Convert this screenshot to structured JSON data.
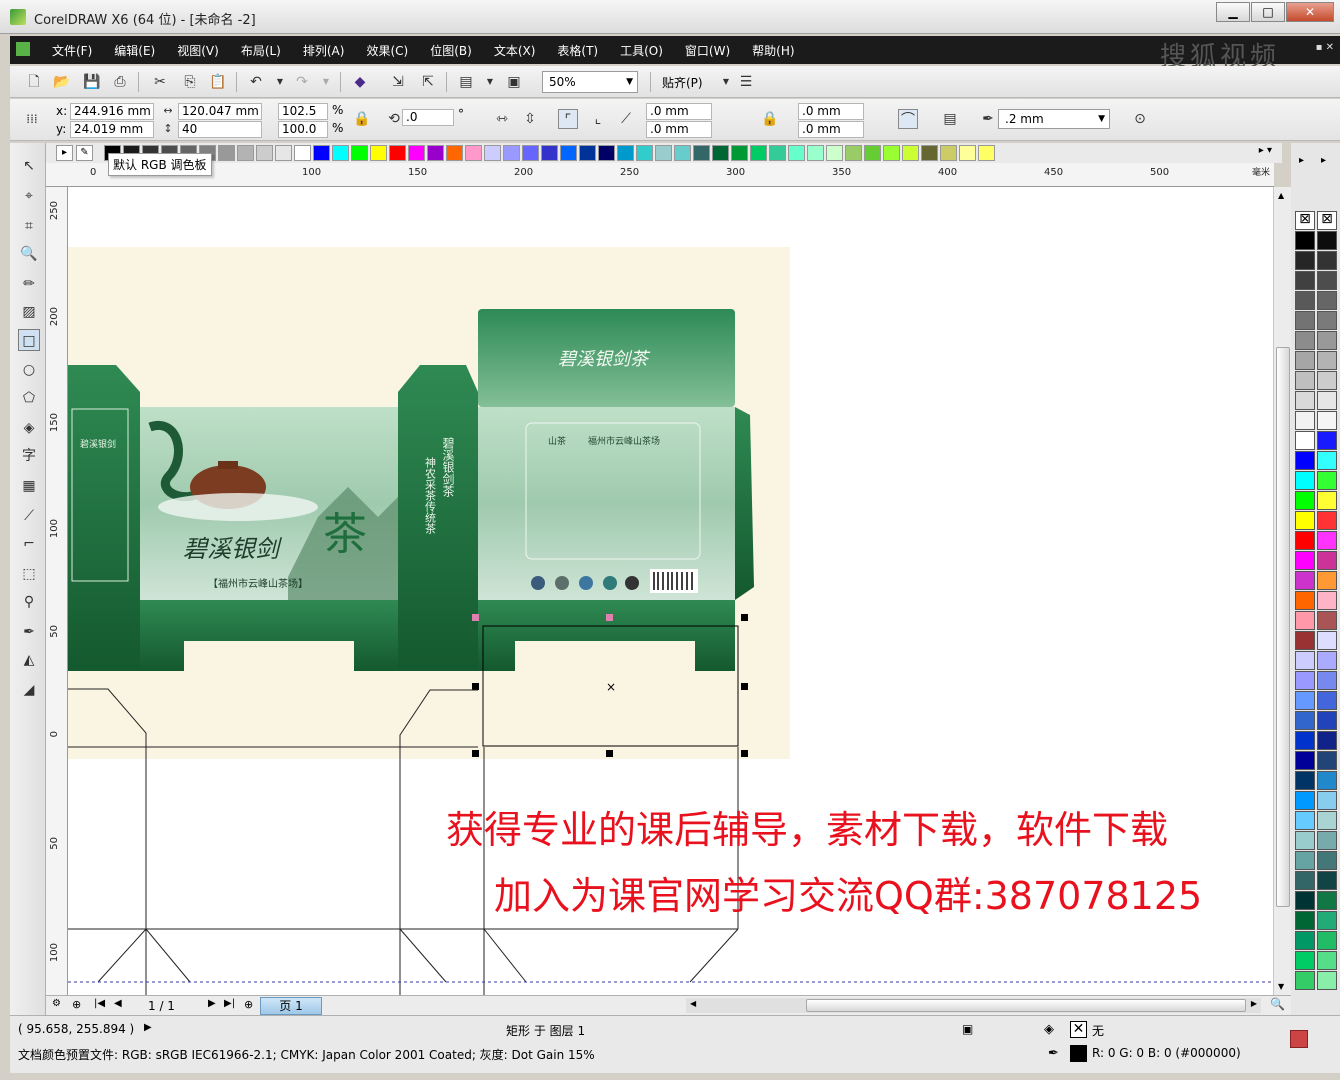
{
  "window": {
    "title": "CorelDRAW X6 (64 位) - [未命名 -2]",
    "min": "▁",
    "max": "□",
    "close": "✕"
  },
  "menu": {
    "items": [
      "文件(F)",
      "编辑(E)",
      "视图(V)",
      "布局(L)",
      "排列(A)",
      "效果(C)",
      "位图(B)",
      "文本(X)",
      "表格(T)",
      "工具(O)",
      "窗口(W)",
      "帮助(H)"
    ],
    "watermark": "搜狐视频"
  },
  "toolbar": {
    "zoom": "50%",
    "snap_label": "贴齐(P)"
  },
  "properties": {
    "x_label": "x:",
    "x_value": "244.916 mm",
    "y_label": "y:",
    "y_value": "24.019 mm",
    "width_value": "120.047 mm",
    "height_value": "40",
    "scale_w": "102.5",
    "scale_h": "100.0",
    "percent": "%",
    "rotation": ".0",
    "degree": "°",
    "corner_1": ".0 mm",
    "corner_2": ".0 mm",
    "corner_3": ".0 mm",
    "corner_4": ".0 mm",
    "outline_width": ".2 mm"
  },
  "tooltip": "默认 RGB 调色板",
  "ruler": {
    "h_labels": [
      "0",
      "50",
      "100",
      "150",
      "200",
      "250",
      "300",
      "350",
      "400",
      "450",
      "500"
    ],
    "h_unit": "毫米",
    "v_labels": [
      "250",
      "200",
      "150",
      "100",
      "50",
      "0",
      "50",
      "100"
    ]
  },
  "package": {
    "brand_vertical": "碧溪银剑",
    "front_title": "碧溪银剑",
    "front_subtitle": "【福州市云峰山茶场】",
    "side_text_1": "碧溪银剑茶",
    "side_text_2": "神农采茶传统茶",
    "top_title": "碧溪银剑茶",
    "back_label": "福州市云峰山茶场",
    "logo_text": "山茶"
  },
  "overlay": {
    "line1": "获得专业的课后辅导，素材下载，软件下载",
    "line2": "加入为课官网学习交流QQ群:387078125"
  },
  "pages": {
    "counter": "1 / 1",
    "tab": "页 1"
  },
  "status": {
    "coords": "( 95.658, 255.894 )",
    "object_info": "矩形 于 图层 1",
    "fill_label": "无",
    "outline_color": "R: 0 G: 0 B: 0 (#000000)",
    "color_profile": "文档颜色预置文件: RGB: sRGB IEC61966-2.1; CMYK: Japan Color 2001 Coated; 灰度: Dot Gain 15%"
  },
  "colors": {
    "overlay_red": "#e8111d",
    "package_dark_green": "#1f6e3d",
    "package_light_green": "#a8cfb3",
    "canvas_bg": "#faf4e2"
  },
  "palette_horizontal": [
    "#000000",
    "#1a1a1a",
    "#333333",
    "#4d4d4d",
    "#666666",
    "#808080",
    "#999999",
    "#b3b3b3",
    "#cccccc",
    "#e6e6e6",
    "#ffffff",
    "#0000ff",
    "#00ffff",
    "#00ff00",
    "#ffff00",
    "#ff0000",
    "#ff00ff",
    "#9900cc",
    "#ff6600",
    "#ff99cc",
    "#ccccff",
    "#9999ff",
    "#6666ff",
    "#3333cc",
    "#0066ff",
    "#003399",
    "#000066",
    "#0099cc",
    "#33cccc",
    "#99cccc",
    "#66cccc",
    "#336666",
    "#006633",
    "#009933",
    "#00cc66",
    "#33cc99",
    "#66ffcc",
    "#99ffcc",
    "#ccffcc",
    "#99cc66",
    "#66cc33",
    "#99ff33",
    "#ccff33",
    "#666633",
    "#cccc66",
    "#ffff99",
    "#ffff66"
  ],
  "palette_vertical_left": [
    "#000000",
    "#262626",
    "#404040",
    "#595959",
    "#737373",
    "#8c8c8c",
    "#a6a6a6",
    "#bfbfbf",
    "#d9d9d9",
    "#f2f2f2",
    "#ffffff",
    "#0000ff",
    "#00ffff",
    "#00ff00",
    "#ffff00",
    "#ff0000",
    "#ff00ff",
    "#cc33cc",
    "#ff6600",
    "#ff99aa",
    "#993333",
    "#ccccff",
    "#9999ff",
    "#6699ff",
    "#3366cc",
    "#0033cc",
    "#000099",
    "#003366",
    "#0099ff",
    "#66ccff",
    "#99cccc",
    "#66a3a3",
    "#336666",
    "#003333",
    "#006633",
    "#009966",
    "#00cc66",
    "#33cc66"
  ],
  "palette_vertical_right": [
    "#0d0d0d",
    "#333333",
    "#4d4d4d",
    "#666666",
    "#7a7a7a",
    "#999999",
    "#b3b3b3",
    "#cccccc",
    "#e6e6e6",
    "#f5f5f5",
    "#1a1aff",
    "#33ffff",
    "#33ff33",
    "#ffff33",
    "#ff3333",
    "#ff33ff",
    "#cc3399",
    "#ff9933",
    "#ffb3c6",
    "#aa5555",
    "#ddddff",
    "#aaaaff",
    "#7788ee",
    "#4466dd",
    "#2244bb",
    "#112288",
    "#224477",
    "#2288cc",
    "#88ccee",
    "#aad4d4",
    "#77aaaa",
    "#447777",
    "#114444",
    "#117744",
    "#22aa77",
    "#22bb66",
    "#55dd88",
    "#88eeaa"
  ]
}
